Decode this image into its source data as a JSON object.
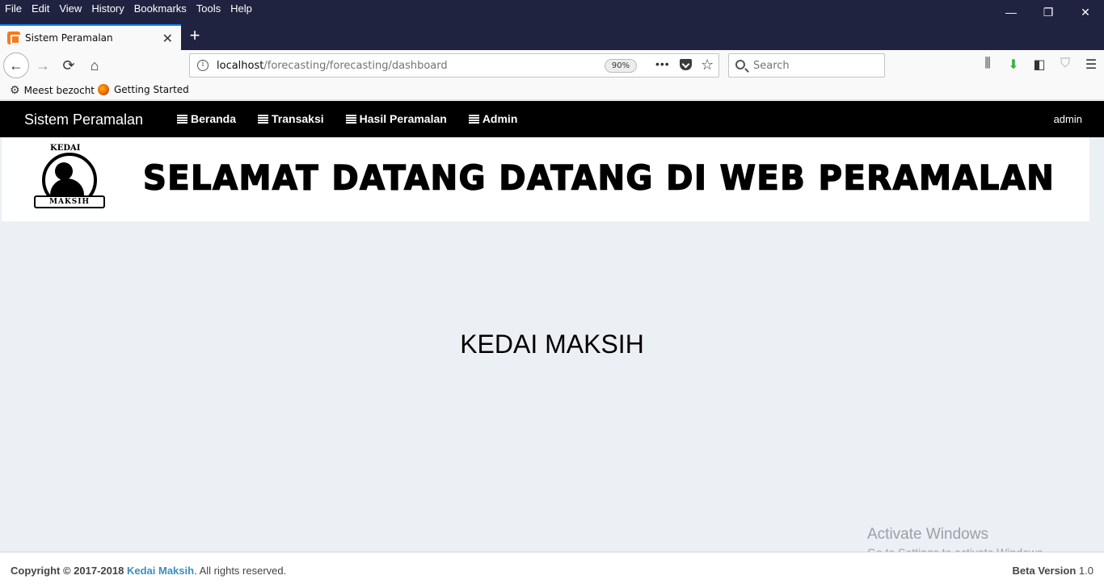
{
  "browser": {
    "menu": [
      "File",
      "Edit",
      "View",
      "History",
      "Bookmarks",
      "Tools",
      "Help"
    ],
    "window_controls": {
      "minimize": "—",
      "restore": "❐",
      "close": "✕"
    },
    "tab": {
      "title": "Sistem Peramalan",
      "close": "✕"
    },
    "new_tab": "+",
    "nav": {
      "back": "←",
      "forward": "→",
      "reload": "⟳",
      "home": "⌂"
    },
    "url": {
      "host": "localhost",
      "path": "/forecasting/forecasting/dashboard",
      "zoom": "90%",
      "actions": "•••",
      "star": "☆"
    },
    "search": {
      "placeholder": "Search"
    },
    "toolbar_icons": [
      "library-icon",
      "download-icon",
      "sidebar-icon",
      "shield-icon",
      "menu-icon"
    ],
    "toolbar_glyphs": [
      "⫼",
      "⬇",
      "◧",
      "⛉",
      "☰"
    ],
    "bookmarks": [
      {
        "label": "Meest bezocht",
        "icon": "gear-icon"
      },
      {
        "label": "Getting Started",
        "icon": "firefox-icon"
      }
    ]
  },
  "app": {
    "brand": "Sistem Peramalan",
    "menu": [
      "Beranda",
      "Transaksi",
      "Hasil Peramalan",
      "Admin"
    ],
    "user": "admin",
    "logo": {
      "top": "KEDAI",
      "bottom": "MAKSIH"
    },
    "banner_text": "SELAMAT DATANG DATANG DI WEB PERAMALAN",
    "main_title": "KEDAI MAKSIH"
  },
  "footer": {
    "copyright_prefix": "Copyright © 2017-2018",
    "company": "Kedai Maksih",
    "suffix": ". All rights reserved.",
    "version_label": "Beta Version",
    "version": "1.0"
  },
  "watermark": {
    "line1": "Activate Windows",
    "line2": "Go to Settings to activate Windows."
  }
}
